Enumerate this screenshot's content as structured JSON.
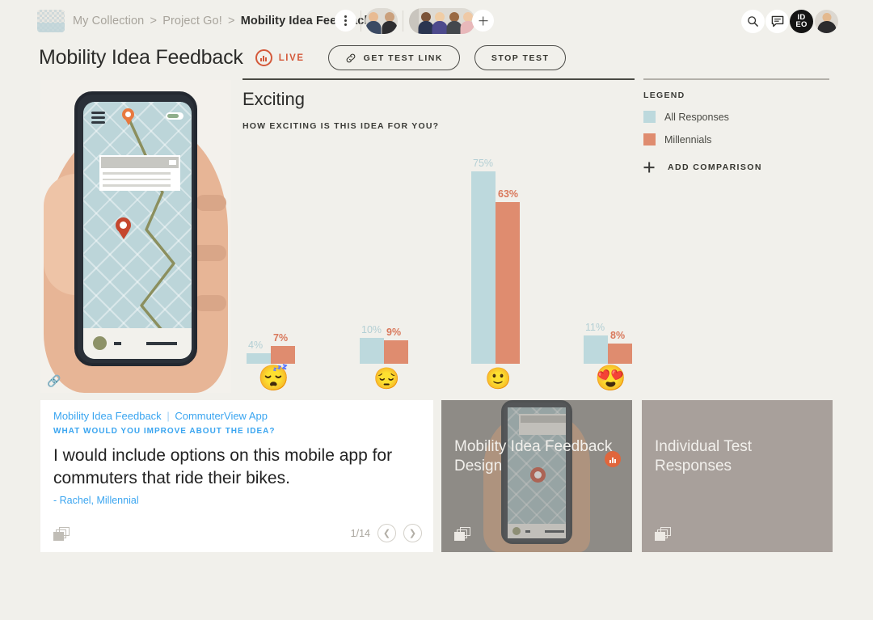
{
  "topbar": {
    "breadcrumb": {
      "level1": "My Collection",
      "level2": "Project Go!",
      "current": "Mobility Idea Feedback",
      "separator": ">"
    },
    "icons": {
      "menu": "vertical-dots-icon",
      "add_member": "plus-icon",
      "search": "search-icon",
      "chat": "chat-icon",
      "brand": "ideo-logo",
      "avatar": "user-avatar"
    },
    "brand_line1": "ID",
    "brand_line2": "EO"
  },
  "header": {
    "title": "Mobility Idea Feedback",
    "live_label": "LIVE",
    "get_test_link_label": "GET TEST LINK",
    "stop_test_label": "STOP TEST",
    "live_color": "#d4593a"
  },
  "chart_data": {
    "type": "bar",
    "title": "Exciting",
    "subtitle": "HOW EXCITING IS THIS IDEA FOR YOU?",
    "categories": [
      "sleeping-face",
      "pensive-face",
      "slightly-smiling-face",
      "smiling-face-with-heart-eyes"
    ],
    "category_emojis": [
      "😴",
      "😔",
      "🙂",
      "😍"
    ],
    "series": [
      {
        "name": "All Responses",
        "color": "#bdd9dd",
        "values": [
          4,
          10,
          75,
          11
        ],
        "labels": [
          "4%",
          "10%",
          "75%",
          "11%"
        ]
      },
      {
        "name": "Millennials",
        "color": "#df8c6f",
        "values": [
          7,
          9,
          63,
          8
        ],
        "labels": [
          "7%",
          "9%",
          "63%",
          "8%"
        ]
      }
    ],
    "ylim": [
      0,
      80
    ],
    "ylabel": "",
    "xlabel": "",
    "grid": false,
    "legend_position": "right"
  },
  "legend": {
    "title": "LEGEND",
    "items": [
      {
        "label": "All Responses",
        "color": "#bdd9dd"
      },
      {
        "label": "Millennials",
        "color": "#df8c6f"
      }
    ],
    "add_comparison_label": "ADD COMPARISON"
  },
  "quote_card": {
    "source_test": "Mobility Idea Feedback",
    "source_sep": "|",
    "source_app": "CommuterView App",
    "question": "WHAT WOULD YOU IMPROVE ABOUT THE IDEA?",
    "quote": "I would include options on this mobile app for commuters that ride their bikes.",
    "attribution": "- Rachel, Millennial",
    "pager": "1/14",
    "prev_icon": "chevron-left-icon",
    "next_icon": "chevron-right-icon",
    "stack_icon": "card-stack-icon"
  },
  "tiles": [
    {
      "title": "Mobility Idea Feedback Design",
      "badge": "bar-chart-badge",
      "bg": "#8e8b86"
    },
    {
      "title": "Individual Test Responses",
      "badge": null,
      "bg": "#a8a09b"
    }
  ],
  "hero": {
    "link_icon": "link-icon",
    "alt": "hand-holding-phone-map-illustration"
  }
}
